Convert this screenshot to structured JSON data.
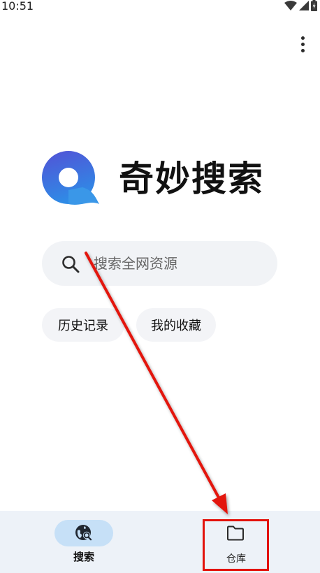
{
  "status_bar": {
    "time": "10:51",
    "icons": [
      "wifi-icon",
      "signal-icon",
      "battery-charging-icon"
    ]
  },
  "header": {
    "more_icon": "more-vert-icon"
  },
  "app": {
    "title": "奇妙搜索",
    "logo_colors": {
      "top": "#4f58d9",
      "bottom": "#2f8ae6",
      "tail": "#3a9ae8"
    }
  },
  "search": {
    "placeholder": "搜索全网资源",
    "icon": "search-icon"
  },
  "quick_actions": [
    {
      "label": "历史记录"
    },
    {
      "label": "我的收藏"
    }
  ],
  "bottom_nav": {
    "items": [
      {
        "label": "搜索",
        "icon": "globe-search-icon",
        "active": true
      },
      {
        "label": "仓库",
        "icon": "folder-icon",
        "active": false
      }
    ]
  },
  "annotation": {
    "color": "#e3120b",
    "shapes": [
      "arrow",
      "highlight-box"
    ]
  }
}
